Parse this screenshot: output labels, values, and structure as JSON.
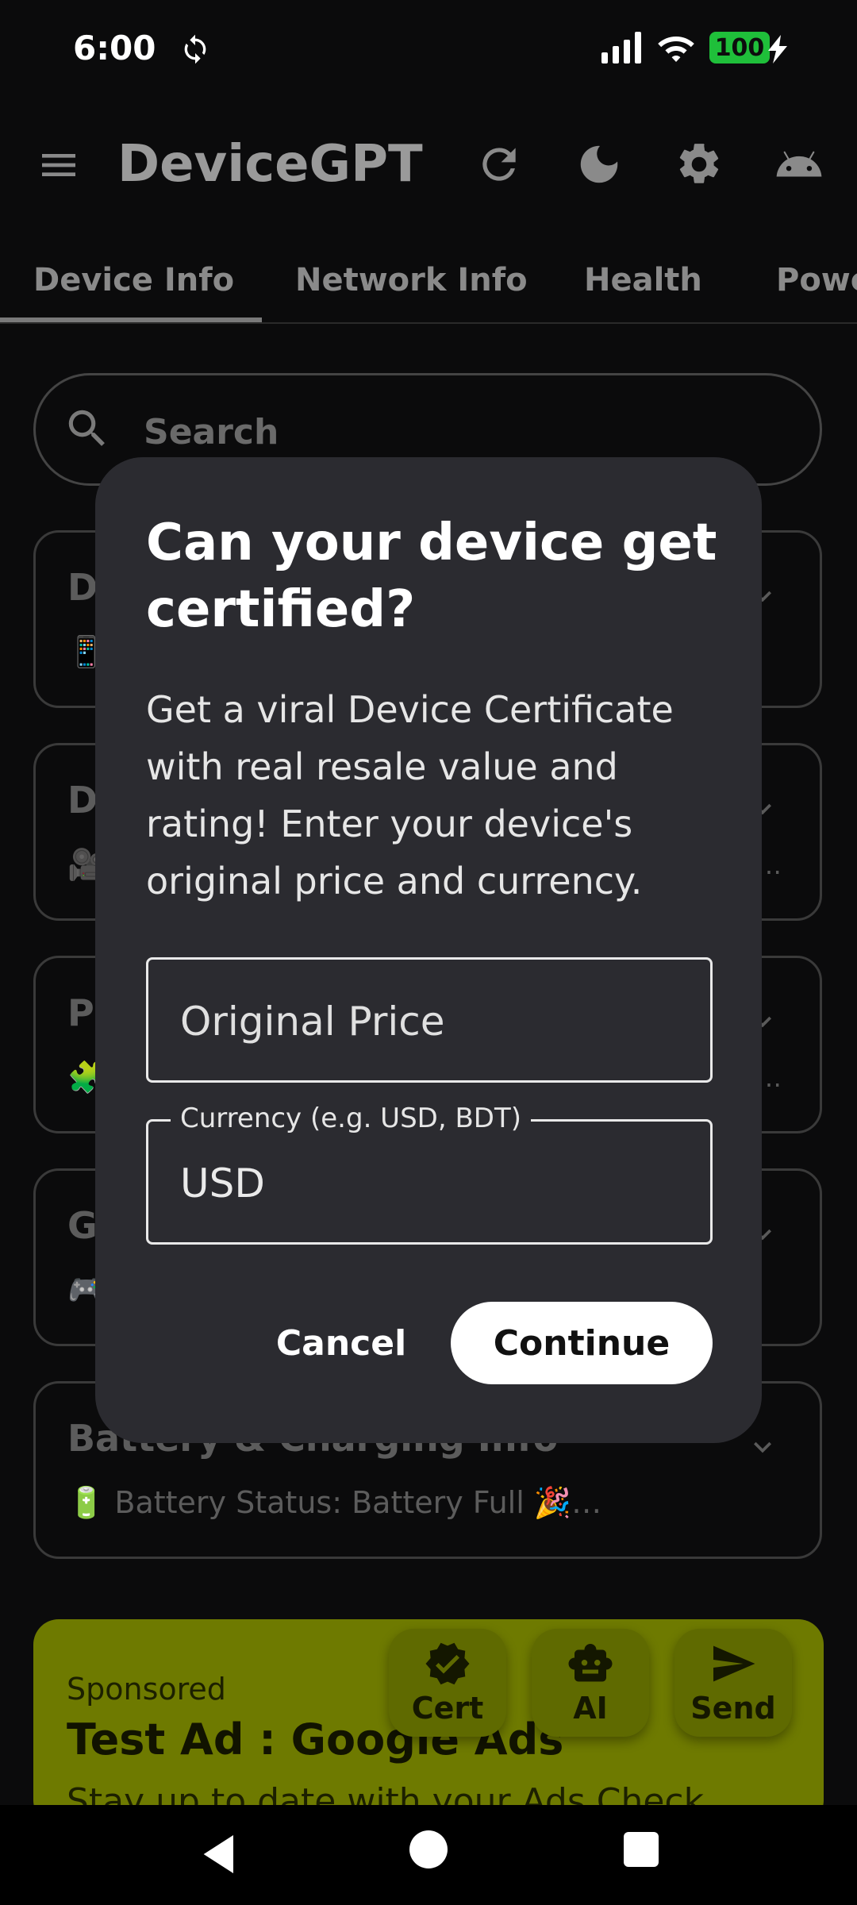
{
  "status_bar": {
    "time": "6:00",
    "battery": "100",
    "icons": [
      "sync-icon",
      "signal-icon",
      "wifi-icon",
      "battery-icon",
      "charging-bolt-icon"
    ]
  },
  "app_bar": {
    "title": "DeviceGPT",
    "actions": [
      "refresh-icon",
      "dark-mode-icon",
      "settings-icon",
      "android-icon"
    ]
  },
  "tabs": [
    {
      "label": "Device Info",
      "active": true
    },
    {
      "label": "Network Info",
      "active": false
    },
    {
      "label": "Health",
      "active": false
    },
    {
      "label": "Powe",
      "active": false
    }
  ],
  "search": {
    "placeholder": "Search"
  },
  "cards": [
    {
      "title": "D",
      "subtitle": "📱",
      "trail": ""
    },
    {
      "title": "D",
      "subtitle": "🎥",
      "trail": "…"
    },
    {
      "title": "Pr",
      "subtitle": "🧩",
      "trail": "…"
    },
    {
      "title": "G",
      "subtitle": "🎮",
      "trail": ""
    },
    {
      "title": "Battery & Charging Info",
      "subtitle": "🔋 Battery Status: Battery Full 🎉…",
      "trail": ""
    }
  ],
  "ad": {
    "sponsored": "Sponsored",
    "title": "Test Ad : Google Ads",
    "subtitle": "Stay up to date with your Ads Check"
  },
  "fabs": [
    {
      "label": "Cert",
      "icon": "verified-badge-icon"
    },
    {
      "label": "AI",
      "icon": "robot-icon"
    },
    {
      "label": "Send",
      "icon": "send-icon"
    }
  ],
  "dialog": {
    "title": "Can your device get certified?",
    "body": "Get a viral Device Certificate with real resale value and rating! Enter your device's original price and currency.",
    "price_field": {
      "placeholder": "Original Price",
      "value": ""
    },
    "currency_field": {
      "label": "Currency (e.g. USD, BDT)",
      "value": "USD"
    },
    "cancel_label": "Cancel",
    "continue_label": "Continue"
  },
  "colors": {
    "background": "#0b0b0c",
    "dialog": "#2b2b30",
    "ad": "#6e7a00",
    "battery": "#1fbf3a"
  }
}
